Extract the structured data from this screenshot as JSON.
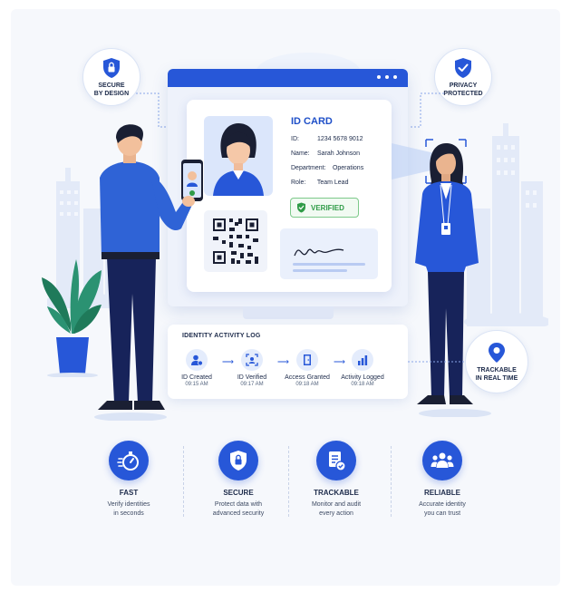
{
  "badges": {
    "secure_by_design": "SECURE\nBY DESIGN",
    "privacy_protected": "PRIVACY\nPROTECTED",
    "trackable_real_time": "TRACKABLE\nIN REAL TIME"
  },
  "id_card": {
    "title": "ID CARD",
    "fields": [
      {
        "key": "ID:",
        "value": "1234 5678 9012"
      },
      {
        "key": "Name:",
        "value": "Sarah Johnson"
      },
      {
        "key": "Department:",
        "value": "Operations"
      },
      {
        "key": "Role:",
        "value": "Team Lead"
      }
    ],
    "verified_label": "VERIFIED"
  },
  "activity_log": {
    "title": "IDENTITY ACTIVITY LOG",
    "steps": [
      {
        "label": "ID Created",
        "time": "09:15 AM",
        "icon": "user-plus-icon"
      },
      {
        "label": "ID Verified",
        "time": "09:17 AM",
        "icon": "face-scan-icon"
      },
      {
        "label": "Access Granted",
        "time": "09:18 AM",
        "icon": "door-icon"
      },
      {
        "label": "Activity Logged",
        "time": "09:18 AM",
        "icon": "chart-icon"
      }
    ]
  },
  "features": [
    {
      "title": "FAST",
      "desc": "Verify identities\nin seconds",
      "icon": "stopwatch-icon"
    },
    {
      "title": "SECURE",
      "desc": "Protect data with\nadvanced security",
      "icon": "shield-lock-icon"
    },
    {
      "title": "TRACKABLE",
      "desc": "Monitor and audit\nevery action",
      "icon": "document-check-icon"
    },
    {
      "title": "RELIABLE",
      "desc": "Accurate identity\nyou can trust",
      "icon": "people-icon"
    }
  ],
  "colors": {
    "brand_blue": "#2757d8",
    "navy": "#1c2a4a",
    "verified_green": "#2f9b47"
  }
}
